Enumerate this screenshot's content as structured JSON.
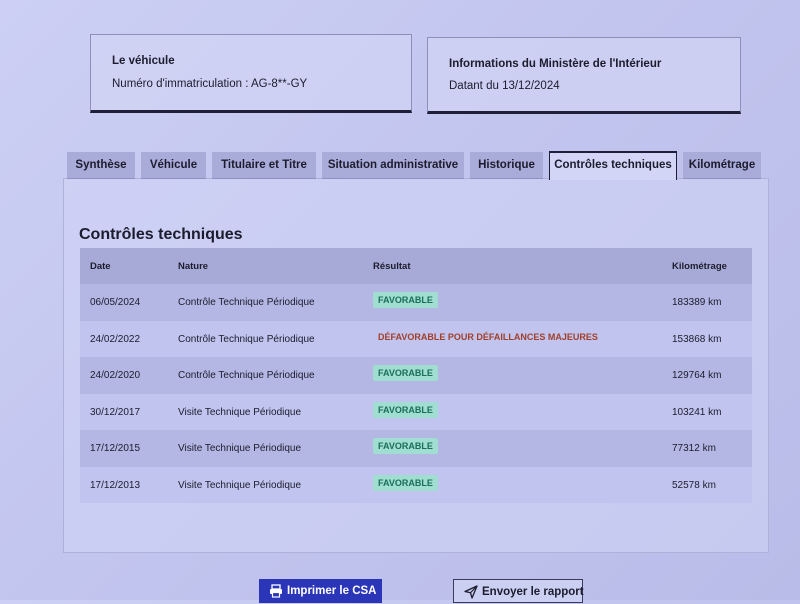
{
  "vehicle_card": {
    "title": "Le véhicule",
    "registration": "Numéro d'immatriculation : AG-8**-GY"
  },
  "ministry_card": {
    "title": "Informations du Ministère de l'Intérieur",
    "date": "Datant du 13/12/2024"
  },
  "tabs": [
    {
      "label": "Synthèse"
    },
    {
      "label": "Véhicule"
    },
    {
      "label": "Titulaire et Titre"
    },
    {
      "label": "Situation administrative"
    },
    {
      "label": "Historique"
    },
    {
      "label": "Contrôles techniques"
    },
    {
      "label": "Kilométrage"
    }
  ],
  "active_tab": "Contrôles techniques",
  "section": {
    "title": "Contrôles techniques",
    "columns": {
      "date": "Date",
      "nature": "Nature",
      "result": "Résultat",
      "mileage": "Kilométrage"
    },
    "rows": [
      {
        "date": "06/05/2024",
        "nature": "Contrôle Technique Périodique",
        "result": "FAVORABLE",
        "mileage": "183389 km"
      },
      {
        "date": "24/02/2022",
        "nature": "Contrôle Technique Périodique",
        "result": "DÉFAVORABLE POUR DÉFAILLANCES MAJEURES",
        "mileage": "153868 km"
      },
      {
        "date": "24/02/2020",
        "nature": "Contrôle Technique Périodique",
        "result": "FAVORABLE",
        "mileage": "129764 km"
      },
      {
        "date": "30/12/2017",
        "nature": "Visite Technique Périodique",
        "result": "FAVORABLE",
        "mileage": "103241 km"
      },
      {
        "date": "17/12/2015",
        "nature": "Visite Technique Périodique",
        "result": "FAVORABLE",
        "mileage": "77312 km"
      },
      {
        "date": "17/12/2013",
        "nature": "Visite Technique Périodique",
        "result": "FAVORABLE",
        "mileage": "52578 km"
      }
    ]
  },
  "buttons": {
    "print": {
      "label": "Imprimer le CSA",
      "icon": "printer-icon"
    },
    "send": {
      "label": "Envoyer le rapport",
      "icon": "send-icon"
    }
  },
  "colors": {
    "accent": "#2a35b8",
    "favorable_bg": "#9fded0",
    "favorable_text": "#1b6e5a",
    "unfavorable_text": "#a0402b"
  }
}
